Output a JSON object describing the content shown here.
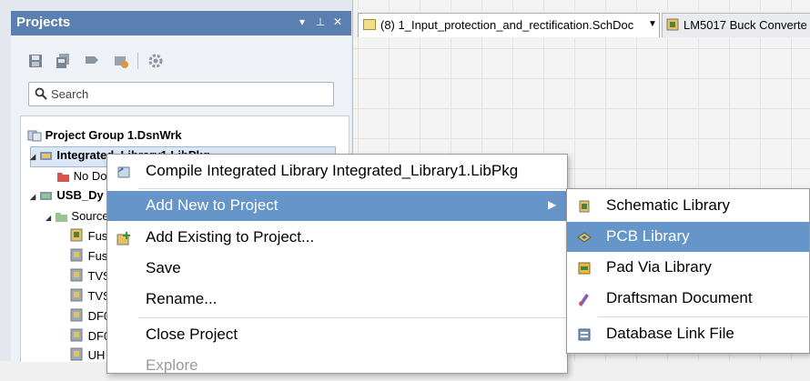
{
  "panel": {
    "title": "Projects",
    "search_placeholder": "Search"
  },
  "tree": [
    {
      "label": "Project Group 1.DsnWrk",
      "bold": true
    },
    {
      "label": "Integrated_Library1.LibPkg",
      "bold": true
    },
    {
      "label": "No Documents Added",
      "bold": false
    },
    {
      "label": "USB_Dy",
      "bold": true
    },
    {
      "label": "Source",
      "bold": false
    },
    {
      "label": "Fus",
      "bold": false
    },
    {
      "label": "Fus",
      "bold": false
    },
    {
      "label": "TVS",
      "bold": false
    },
    {
      "label": "TVS",
      "bold": false
    },
    {
      "label": "DF0",
      "bold": false
    },
    {
      "label": "DF0",
      "bold": false
    },
    {
      "label": "UH",
      "bold": false
    }
  ],
  "tabs": [
    {
      "label": "(8) 1_Input_protection_and_rectification.SchDoc"
    },
    {
      "label": "LM5017 Buck Converte"
    }
  ],
  "context_menu": {
    "items": [
      {
        "label": "Compile Integrated Library Integrated_Library1.LibPkg"
      },
      {
        "label": "Add New to Project"
      },
      {
        "label": "Add Existing to Project..."
      },
      {
        "label": "Save"
      },
      {
        "label": "Rename..."
      },
      {
        "label": "Close Project"
      },
      {
        "label": "Explore"
      }
    ]
  },
  "submenu": {
    "items": [
      {
        "label": "Schematic Library"
      },
      {
        "label": "PCB Library"
      },
      {
        "label": "Pad Via Library"
      },
      {
        "label": "Draftsman Document"
      },
      {
        "label": "Database Link File"
      }
    ]
  },
  "colors": {
    "highlight": "#6695c9",
    "panel_header": "#5b7fb0"
  }
}
